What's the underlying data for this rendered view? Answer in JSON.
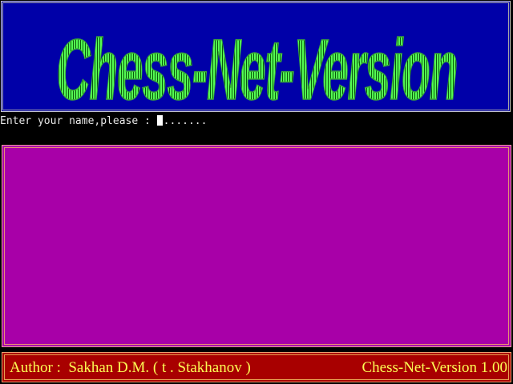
{
  "banner": {
    "logo_text": "Chess-Net-Version",
    "background": "#0000a8",
    "logo_color": "#54fc54"
  },
  "prompt": {
    "label": "Enter your name,please : ",
    "value": ".......",
    "text_color": "#e8e8e8"
  },
  "main_panel": {
    "background": "#a800a8"
  },
  "footer": {
    "author": "Author :  Sakhan D.M. ( t . Stakhanov )",
    "version": "Chess-Net-Version 1.00",
    "background": "#a80000",
    "text_color": "#fcfc54"
  }
}
